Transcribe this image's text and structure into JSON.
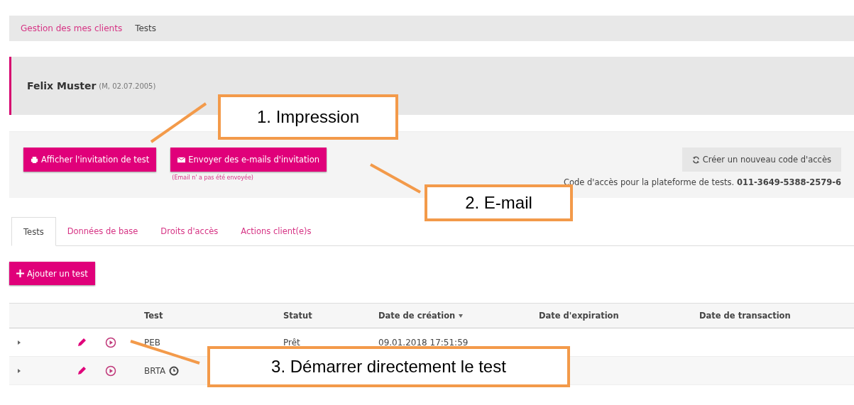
{
  "breadcrumb": [
    {
      "label": "Gestion des mes clients",
      "kind": "link"
    },
    {
      "label": "Tests",
      "kind": "current"
    }
  ],
  "client": {
    "name": "Felix Muster",
    "details": "(M, 02.07.2005)"
  },
  "actions": {
    "show_invitation": "Afficher l'invitation de test",
    "send_invitation": "Envoyer des e-mails d'invitation",
    "send_note": "(Email n' a pas été envoyée)",
    "new_code": "Créer un nouveau code d'accès",
    "code_label": "Code d'accès pour la plateforme de tests.",
    "code": "011-3649-5388-2579-6"
  },
  "tabs": [
    {
      "label": "Tests",
      "selected": true
    },
    {
      "label": "Données de base",
      "selected": false
    },
    {
      "label": "Droits d'accès",
      "selected": false
    },
    {
      "label": "Actions client(e)s",
      "selected": false
    }
  ],
  "add_button": "Ajouter un test",
  "table": {
    "columns": [
      {
        "label": "Test",
        "sorted": false
      },
      {
        "label": "Statut",
        "sorted": false
      },
      {
        "label": "Date de création",
        "sorted": true
      },
      {
        "label": "Date d'expiration",
        "sorted": false
      },
      {
        "label": "Date de transaction",
        "sorted": false
      }
    ],
    "rows": [
      {
        "test": "PEB",
        "timed": false,
        "status": "Prêt",
        "created": "09.01.2018 17:51:59"
      },
      {
        "test": "BRTA",
        "timed": true
      }
    ]
  },
  "callouts": [
    {
      "text": "1. Impression"
    },
    {
      "text": "2. E-mail"
    },
    {
      "text": "3. Démarrer directement le test"
    }
  ]
}
